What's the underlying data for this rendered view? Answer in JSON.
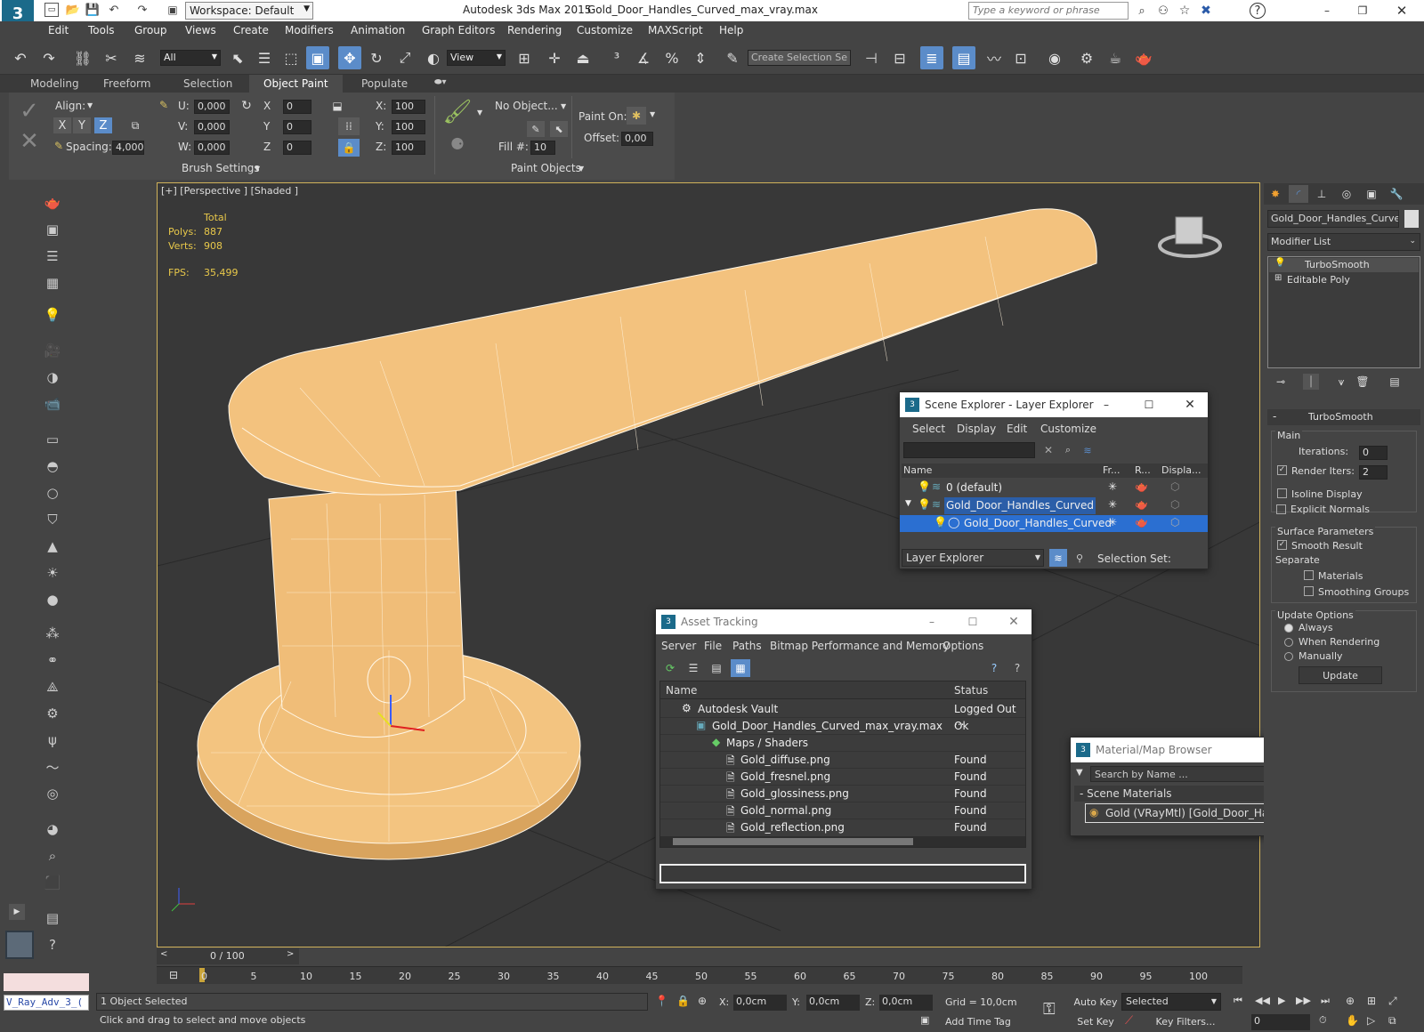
{
  "titlebar": {
    "workspace": "Workspace: Default",
    "app_title": "Autodesk 3ds Max  2015",
    "file_name": "Gold_Door_Handles_Curved_max_vray.max",
    "search_placeholder": "Type a keyword or phrase"
  },
  "menu": [
    "Edit",
    "Tools",
    "Group",
    "Views",
    "Create",
    "Modifiers",
    "Animation",
    "Graph Editors",
    "Rendering",
    "Customize",
    "MAXScript",
    "Help"
  ],
  "toolbar": {
    "selection_filter": "All",
    "ref_coord": "View",
    "selection_set_placeholder": "Create Selection Se"
  },
  "ribbon_tabs": [
    "Modeling",
    "Freeform",
    "Selection",
    "Object Paint",
    "Populate"
  ],
  "ribbon": {
    "align_label": "Align:",
    "axes": [
      "X",
      "Y",
      "Z"
    ],
    "spacing_label": "Spacing:",
    "spacing_value": "4,000",
    "u_label": "U:",
    "u_value": "0,000",
    "v_label": "V:",
    "v_value": "0,000",
    "w_label": "W:",
    "w_value": "0,000",
    "x_label": "X",
    "x_value": "0",
    "y_label": "Y",
    "y_value": "0",
    "z_label": "Z",
    "z_value": "0",
    "sx_label": "X:",
    "sx_value": "100",
    "sy_label": "Y:",
    "sy_value": "100",
    "sz_label": "Z:",
    "sz_value": "100",
    "brush_settings": "Brush Settings",
    "no_object": "No Object...",
    "fill_label": "Fill #:",
    "fill_value": "10",
    "paint_on_label": "Paint On:",
    "offset_label": "Offset:",
    "offset_value": "0,00",
    "paint_objects": "Paint Objects"
  },
  "viewport": {
    "label": "[+] [Perspective ] [Shaded ]",
    "stats_total": "Total",
    "polys_label": "Polys:",
    "polys": "887",
    "verts_label": "Verts:",
    "verts": "908",
    "fps_label": "FPS:",
    "fps": "35,499"
  },
  "command_panel": {
    "object_name": "Gold_Door_Handles_Curved",
    "modifier_list": "Modifier List",
    "stack": [
      "TurboSmooth",
      "Editable Poly"
    ],
    "rollout_title": "TurboSmooth",
    "main_group": "Main",
    "iterations_label": "Iterations:",
    "iterations": "0",
    "render_iters_label": "Render Iters:",
    "render_iters": "2",
    "isoline_display": "Isoline Display",
    "explicit_normals": "Explicit Normals",
    "surface_params": "Surface Parameters",
    "smooth_result": "Smooth Result",
    "separate": "Separate",
    "materials": "Materials",
    "smoothing_groups": "Smoothing Groups",
    "update_options": "Update Options",
    "always": "Always",
    "when_rendering": "When Rendering",
    "manually": "Manually",
    "update_button": "Update"
  },
  "scene_explorer": {
    "title": "Scene Explorer - Layer Explorer",
    "menu": [
      "Select",
      "Display",
      "Edit",
      "Customize"
    ],
    "columns": [
      "Name",
      "Fr...",
      "R...",
      "Displa..."
    ],
    "rows": [
      "0 (default)",
      "Gold_Door_Handles_Curved",
      "Gold_Door_Handles_Curved"
    ],
    "footer_mode": "Layer Explorer",
    "selection_set_label": "Selection Set:"
  },
  "asset_tracking": {
    "title": "Asset Tracking",
    "menu": [
      "Server",
      "File",
      "Paths",
      "Bitmap Performance and Memory",
      "Options"
    ],
    "columns": [
      "Name",
      "Status"
    ],
    "rows": [
      {
        "name": "Autodesk Vault",
        "status": "Logged Out ..."
      },
      {
        "name": "Gold_Door_Handles_Curved_max_vray.max",
        "status": "Ok"
      },
      {
        "name": "Maps / Shaders",
        "status": ""
      },
      {
        "name": "Gold_diffuse.png",
        "status": "Found"
      },
      {
        "name": "Gold_fresnel.png",
        "status": "Found"
      },
      {
        "name": "Gold_glossiness.png",
        "status": "Found"
      },
      {
        "name": "Gold_normal.png",
        "status": "Found"
      },
      {
        "name": "Gold_reflection.png",
        "status": "Found"
      }
    ]
  },
  "material_browser": {
    "title": "Material/Map Browser",
    "search_placeholder": "Search by Name ...",
    "group": "- Scene Materials",
    "item": "Gold  (VRayMtl) [Gold_Door_Handles_Curved]"
  },
  "timeline": {
    "frame": "0 / 100",
    "ticks": [
      "0",
      "5",
      "10",
      "15",
      "20",
      "25",
      "30",
      "35",
      "40",
      "45",
      "50",
      "55",
      "60",
      "65",
      "70",
      "75",
      "80",
      "85",
      "90",
      "95",
      "100"
    ]
  },
  "status": {
    "maxscript": "V_Ray_Adv_3_(",
    "selected_count": "1 Object Selected",
    "prompt": "Click and drag to select and move objects",
    "x_label": "X:",
    "x_value": "0,0cm",
    "y_label": "Y:",
    "y_value": "0,0cm",
    "z_label": "Z:",
    "z_value": "0,0cm",
    "grid": "Grid = 10,0cm",
    "add_time_tag": "Add Time Tag",
    "auto_key": "Auto Key",
    "set_key": "Set Key",
    "selected_dropdown": "Selected",
    "key_filters": "Key Filters...",
    "frame_value": "0"
  },
  "colors": {
    "accent": "#5b8cc9",
    "viewport_border": "#d0b25a",
    "model": "#f2c07a",
    "selection": "#2b6fd1"
  }
}
